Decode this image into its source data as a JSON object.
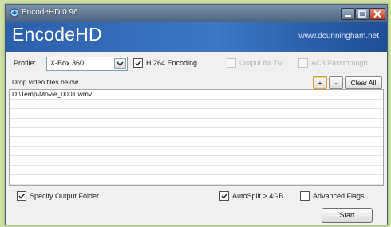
{
  "window": {
    "title": "EncodeHD 0.96",
    "brand": "EncodeHD",
    "website": "www.dcunningham.net"
  },
  "options": {
    "profile_label": "Profile:",
    "profile_value": "X-Box 360",
    "h264_label": "H.264 Encoding",
    "h264_checked": true,
    "output_tv_label": "Output for TV",
    "output_tv_checked": false,
    "ac3_label": "AC3 Passthrough",
    "ac3_checked": false
  },
  "filelist": {
    "drop_label": "Drop video files below",
    "add_label": "+",
    "remove_label": "-",
    "clear_label": "Clear All",
    "files": [
      "D:\\Temp\\Movie_0001.wmv"
    ]
  },
  "bottom": {
    "specify_output_label": "Specify Output Folder",
    "specify_output_checked": true,
    "autosplit_label": "AutoSplit > 4GB",
    "autosplit_checked": true,
    "advanced_label": "Advanced Flags",
    "advanced_checked": false,
    "start_label": "Start"
  },
  "colors": {
    "banner": "#2b5faa",
    "titlebar": "#5a6f8c",
    "close_button": "#d9472c"
  },
  "icons": {
    "app_icon": "encodehd-app-icon",
    "minimize": "minimize-icon",
    "maximize": "maximize-icon",
    "close": "close-icon",
    "dropdown": "chevron-down-icon",
    "check": "checkmark-icon"
  }
}
